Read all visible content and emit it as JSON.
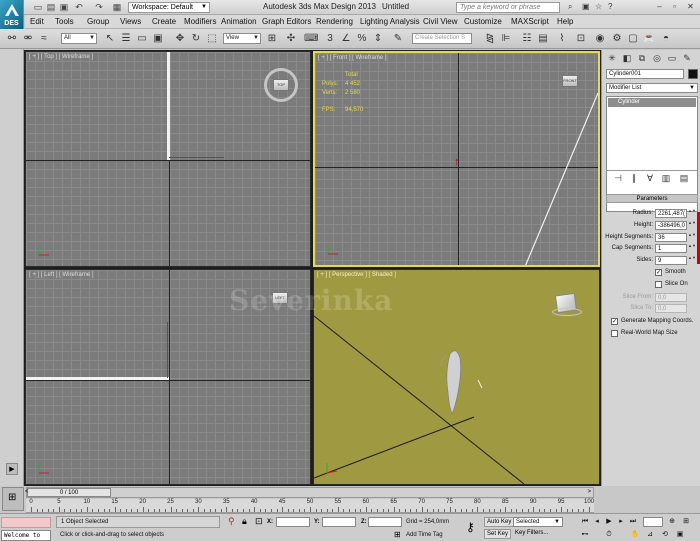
{
  "titlebar": {
    "workspace": "Workspace: Default",
    "app_title": "Autodesk 3ds Max Design 2013",
    "doc_title": "Untitled",
    "search_placeholder": "Type a keyword or phrase",
    "logo_text": "DES"
  },
  "menu": [
    "Edit",
    "Tools",
    "Group",
    "Views",
    "Create",
    "Modifiers",
    "Animation",
    "Graph Editors",
    "Rendering",
    "Lighting Analysis",
    "Civil View",
    "Customize",
    "MAXScript",
    "Help"
  ],
  "toolbar": {
    "selection_filter": "All",
    "ref_coord": "View",
    "snap_label": "3",
    "named_selection_placeholder": "Create Selection S"
  },
  "viewports": {
    "top": {
      "label": "[ + ] [ Top ] [ Wireframe ]",
      "cube": "TOP"
    },
    "front": {
      "label": "[ + ] [ Front ] [ Wireframe ]",
      "cube": "FRONT"
    },
    "left": {
      "label": "[ + ] [ Left ] [ Wireframe ]",
      "cube": "LEFT"
    },
    "perspective": {
      "label": "[ + ] [ Perspective ] [ Shaded ]"
    },
    "stats": {
      "total_label": "Total",
      "polys_label": "Polys:",
      "polys_value": "4 452",
      "verts_label": "Verts:",
      "verts_value": "2 580",
      "fps_label": "FPS:",
      "fps_value": "94,570"
    },
    "watermark": "Severinka"
  },
  "command_panel": {
    "object_name": "Cylinder001",
    "modifier_list": "Modifier List",
    "stack_item": "Cylinder",
    "rollout": "Parameters",
    "params": [
      {
        "label": "Radius:",
        "value": "2261,487("
      },
      {
        "label": "Height:",
        "value": "-386496,0"
      },
      {
        "label": "Height Segments:",
        "value": "36"
      },
      {
        "label": "Cap Segments:",
        "value": "1"
      },
      {
        "label": "Sides:",
        "value": "9"
      }
    ],
    "smooth_label": "Smooth",
    "slice_on_label": "Slice On",
    "slice_from_label": "Slice From:",
    "slice_from_value": "0,0",
    "slice_to_label": "Slice To:",
    "slice_to_value": "0,0",
    "gen_mapping_label": "Generate Mapping Coords.",
    "real_world_label": "Real-World Map Size"
  },
  "timeline": {
    "frame_counter": "0 / 100",
    "ticks": [
      "0",
      "5",
      "10",
      "15",
      "20",
      "25",
      "30",
      "35",
      "40",
      "45",
      "50",
      "55",
      "60",
      "65",
      "70",
      "75",
      "80",
      "85",
      "90",
      "95",
      "100"
    ]
  },
  "status": {
    "maxscript_text": "Welcome to",
    "selection": "1 Object Selected",
    "prompt": "Click or click-and-drag to select objects",
    "x_label": "X:",
    "y_label": "Y:",
    "z_label": "Z:",
    "grid": "Grid = 254,0mm",
    "add_time_tag": "Add Time Tag",
    "auto_key": "Auto Key",
    "set_key": "Set Key",
    "selected_combo": "Selected",
    "key_filters": "Key Filters..."
  }
}
